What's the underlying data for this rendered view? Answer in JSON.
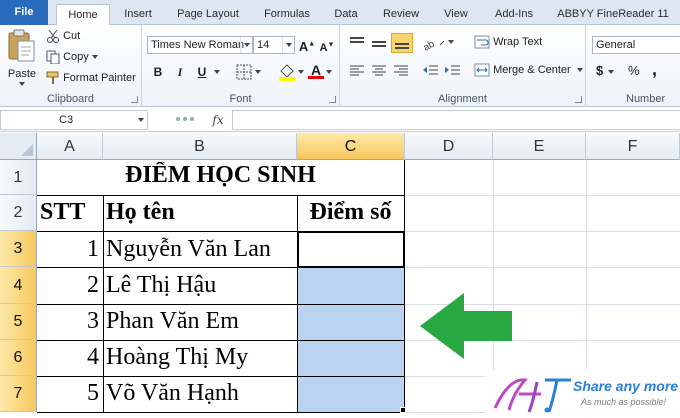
{
  "ribbon_tabs": [
    "File",
    "Home",
    "Insert",
    "Page Layout",
    "Formulas",
    "Data",
    "Review",
    "View",
    "Add-Ins",
    "ABBYY FineReader 11"
  ],
  "clipboard": {
    "paste": "Paste",
    "cut": "Cut",
    "copy": "Copy",
    "format_painter": "Format Painter",
    "label": "Clipboard"
  },
  "font": {
    "name": "Times New Roman",
    "size": "14",
    "bold": "B",
    "italic": "I",
    "underline": "U",
    "label": "Font"
  },
  "alignment": {
    "wrap_text": "Wrap Text",
    "merge_center": "Merge & Center",
    "label": "Alignment"
  },
  "number": {
    "format": "General",
    "currency": "$",
    "percent": "%",
    "comma": ",",
    "label": "Number"
  },
  "formula_bar": {
    "name_box": "C3",
    "fx": "fx",
    "content": ""
  },
  "columns": [
    "A",
    "B",
    "C",
    "D",
    "E",
    "F"
  ],
  "rows": [
    "1",
    "2",
    "3",
    "4",
    "5",
    "6",
    "7"
  ],
  "sheet": {
    "title": "ĐIỂM HỌC SINH",
    "headers": [
      "STT",
      "Họ tên",
      "Điểm số"
    ],
    "students": [
      {
        "stt": "1",
        "name": "Nguyễn Văn Lan"
      },
      {
        "stt": "2",
        "name": "Lê Thị Hậu"
      },
      {
        "stt": "3",
        "name": "Phan Văn Em"
      },
      {
        "stt": "4",
        "name": "Hoàng Thị My"
      },
      {
        "stt": "5",
        "name": "Võ Văn Hạnh"
      }
    ]
  },
  "watermark": {
    "logo": "H.T",
    "tagline": "Share any more",
    "subline": "As much as possible!"
  },
  "colors": {
    "accent": "#2a6bbd",
    "selection_fill": "#b9d3f0",
    "arrow": "#27a843",
    "header_highlight": "#f7c85c"
  }
}
